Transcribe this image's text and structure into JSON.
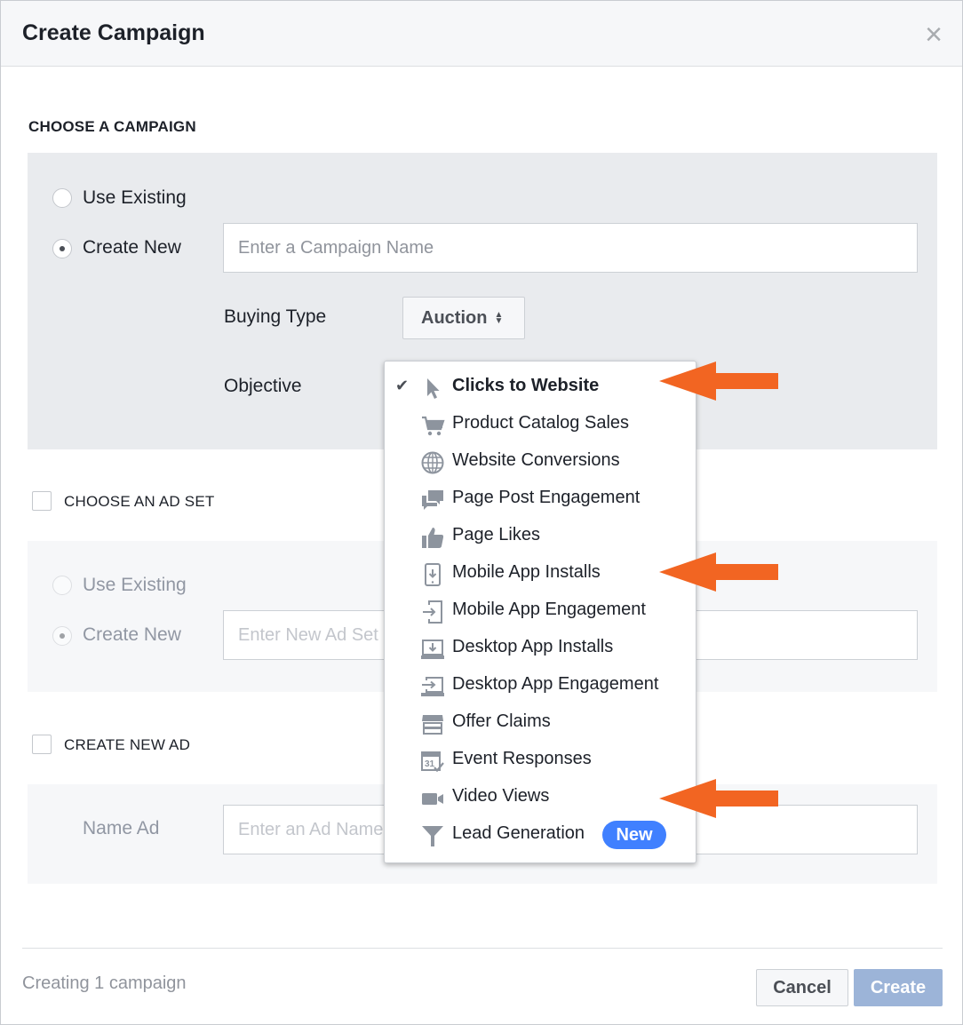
{
  "dialog": {
    "title": "Create Campaign",
    "close_glyph": "×"
  },
  "campaign_section": {
    "title": "CHOOSE A CAMPAIGN",
    "use_existing_label": "Use Existing",
    "create_new_label": "Create New",
    "selected_option": "Create New",
    "name_placeholder": "Enter a Campaign Name",
    "buying_type_label": "Buying Type",
    "buying_type_value": "Auction",
    "objective_label": "Objective"
  },
  "ad_set_section": {
    "title": "CHOOSE AN AD SET",
    "use_existing_label": "Use Existing",
    "create_new_label": "Create New",
    "name_placeholder": "Enter New Ad Set Name"
  },
  "ad_section": {
    "title": "CREATE NEW AD",
    "name_label": "Name Ad",
    "name_placeholder": "Enter an Ad Name"
  },
  "footer": {
    "status": "Creating 1 campaign",
    "cancel_label": "Cancel",
    "create_label": "Create"
  },
  "objective_menu": {
    "selected": "Clicks to Website",
    "check_glyph": "✔",
    "items": [
      {
        "label": "Clicks to Website",
        "icon": "cursor-icon"
      },
      {
        "label": "Product Catalog Sales",
        "icon": "cart-icon"
      },
      {
        "label": "Website Conversions",
        "icon": "globe-icon"
      },
      {
        "label": "Page Post Engagement",
        "icon": "speech-bubbles-icon"
      },
      {
        "label": "Page Likes",
        "icon": "thumbs-up-icon"
      },
      {
        "label": "Mobile App Installs",
        "icon": "mobile-download-icon"
      },
      {
        "label": "Mobile App Engagement",
        "icon": "mobile-enter-icon"
      },
      {
        "label": "Desktop App Installs",
        "icon": "desktop-download-icon"
      },
      {
        "label": "Desktop App Engagement",
        "icon": "desktop-enter-icon"
      },
      {
        "label": "Offer Claims",
        "icon": "storefront-icon"
      },
      {
        "label": "Event Responses",
        "icon": "calendar-check-icon"
      },
      {
        "label": "Video Views",
        "icon": "video-camera-icon"
      },
      {
        "label": "Lead Generation",
        "icon": "funnel-icon",
        "badge": "New"
      }
    ]
  },
  "colors": {
    "annotation_arrow": "#f26522",
    "badge_blue": "#4080ff",
    "create_button_disabled": "#9cb4d8"
  }
}
